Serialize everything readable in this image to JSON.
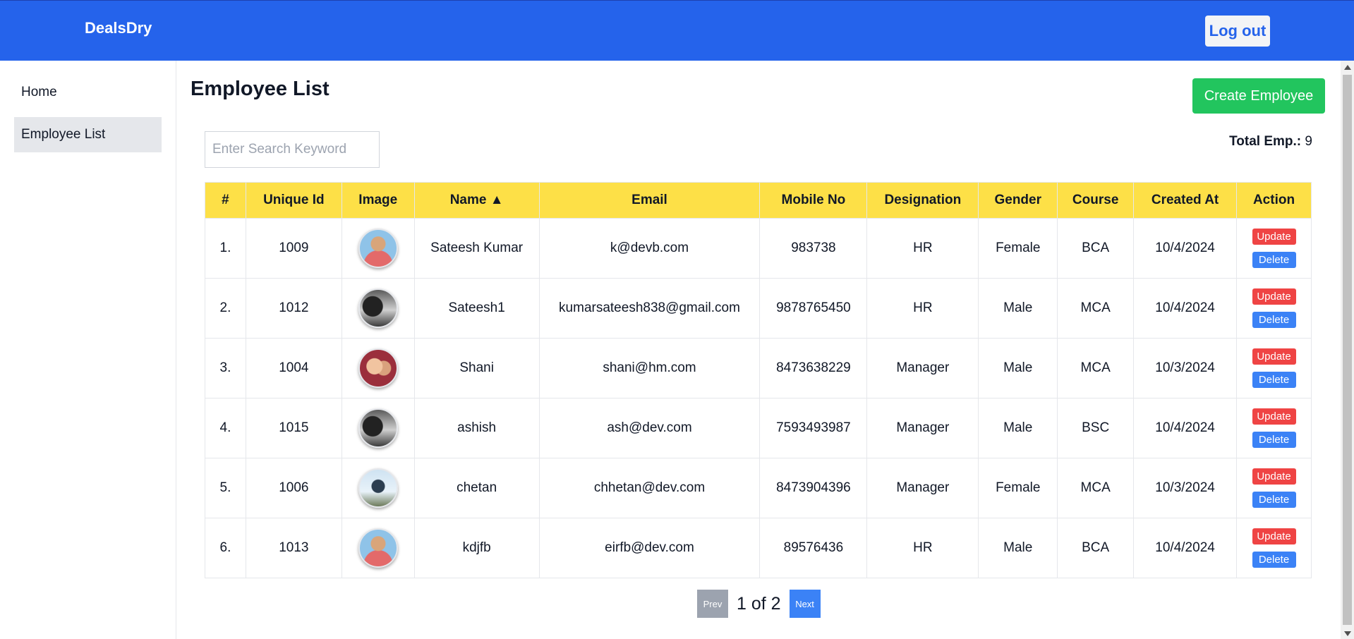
{
  "header": {
    "brand": "DealsDry",
    "logout_label": "Log out"
  },
  "sidebar": {
    "items": [
      {
        "label": "Home"
      },
      {
        "label": "Employee List"
      }
    ]
  },
  "main": {
    "title": "Employee List",
    "create_label": "Create Employee",
    "search_placeholder": "Enter Search Keyword",
    "total_label": "Total Emp.:",
    "total_value": "9"
  },
  "table": {
    "headers": [
      "#",
      "Unique Id",
      "Image",
      "Name ▲",
      "Email",
      "Mobile No",
      "Designation",
      "Gender",
      "Course",
      "Created At",
      "Action"
    ],
    "action_labels": {
      "update": "Update",
      "delete": "Delete"
    },
    "rows": [
      {
        "index": "1.",
        "id": "1009",
        "avatar": "av-blue",
        "name": "Sateesh Kumar",
        "email": "k@devb.com",
        "mobile": "983738",
        "designation": "HR",
        "gender": "Female",
        "course": "BCA",
        "created": "10/4/2024"
      },
      {
        "index": "2.",
        "id": "1012",
        "avatar": "av-dark",
        "name": "Sateesh1",
        "email": "kumarsateesh838@gmail.com",
        "mobile": "9878765450",
        "designation": "HR",
        "gender": "Male",
        "course": "MCA",
        "created": "10/4/2024"
      },
      {
        "index": "3.",
        "id": "1004",
        "avatar": "av-red",
        "name": "Shani",
        "email": "shani@hm.com",
        "mobile": "8473638229",
        "designation": "Manager",
        "gender": "Male",
        "course": "MCA",
        "created": "10/3/2024"
      },
      {
        "index": "4.",
        "id": "1015",
        "avatar": "av-dark",
        "name": "ashish",
        "email": "ash@dev.com",
        "mobile": "7593493987",
        "designation": "Manager",
        "gender": "Male",
        "course": "BSC",
        "created": "10/4/2024"
      },
      {
        "index": "5.",
        "id": "1006",
        "avatar": "av-sky",
        "name": "chetan",
        "email": "chhetan@dev.com",
        "mobile": "8473904396",
        "designation": "Manager",
        "gender": "Female",
        "course": "MCA",
        "created": "10/3/2024"
      },
      {
        "index": "6.",
        "id": "1013",
        "avatar": "av-blue",
        "name": "kdjfb",
        "email": "eirfb@dev.com",
        "mobile": "89576436",
        "designation": "HR",
        "gender": "Male",
        "course": "BCA",
        "created": "10/4/2024"
      }
    ]
  },
  "pagination": {
    "prev_label": "Prev",
    "info": "1 of 2",
    "next_label": "Next"
  },
  "colors": {
    "header_bg": "#2563eb",
    "table_header_bg": "#fde047",
    "create_btn": "#22c55e",
    "update_btn": "#ef4444",
    "delete_btn": "#3b82f6"
  }
}
